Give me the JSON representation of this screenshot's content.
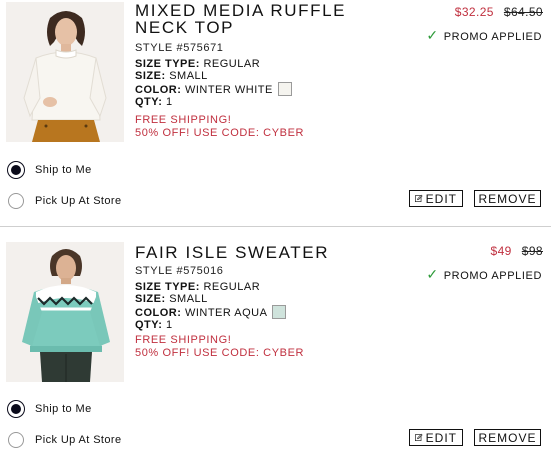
{
  "items": [
    {
      "title": "MIXED MEDIA RUFFLE NECK TOP",
      "style": "STYLE #575671",
      "size_type_label": "SIZE TYPE:",
      "size_type": "REGULAR",
      "size_label": "SIZE:",
      "size": "SMALL",
      "color_label": "COLOR:",
      "color": "WINTER WHITE",
      "swatch_color": "#f5f4ef",
      "qty_label": "QTY:",
      "qty": "1",
      "free_shipping": "FREE SHIPPING!",
      "promo_code": "50% OFF! USE CODE: CYBER",
      "sale_price": "$32.25",
      "original_price": "$64.50",
      "promo_applied": "PROMO APPLIED",
      "ship_to_me": "Ship to Me",
      "pick_up": "Pick Up At Store",
      "edit_label": "EDIT",
      "remove_label": "REMOVE"
    },
    {
      "title": "FAIR ISLE SWEATER",
      "style": "STYLE #575016",
      "size_type_label": "SIZE TYPE:",
      "size_type": "REGULAR",
      "size_label": "SIZE:",
      "size": "SMALL",
      "color_label": "COLOR:",
      "color": "WINTER AQUA",
      "swatch_color": "#cfe3dc",
      "qty_label": "QTY:",
      "qty": "1",
      "free_shipping": "FREE SHIPPING!",
      "promo_code": "50% OFF! USE CODE: CYBER",
      "sale_price": "$49",
      "original_price": "$98",
      "promo_applied": "PROMO APPLIED",
      "ship_to_me": "Ship to Me",
      "pick_up": "Pick Up At Store",
      "edit_label": "EDIT",
      "remove_label": "REMOVE"
    }
  ],
  "colors": {
    "sale": "#c0303f",
    "check": "#2e9b3a",
    "divider": "#cfcfcf"
  }
}
